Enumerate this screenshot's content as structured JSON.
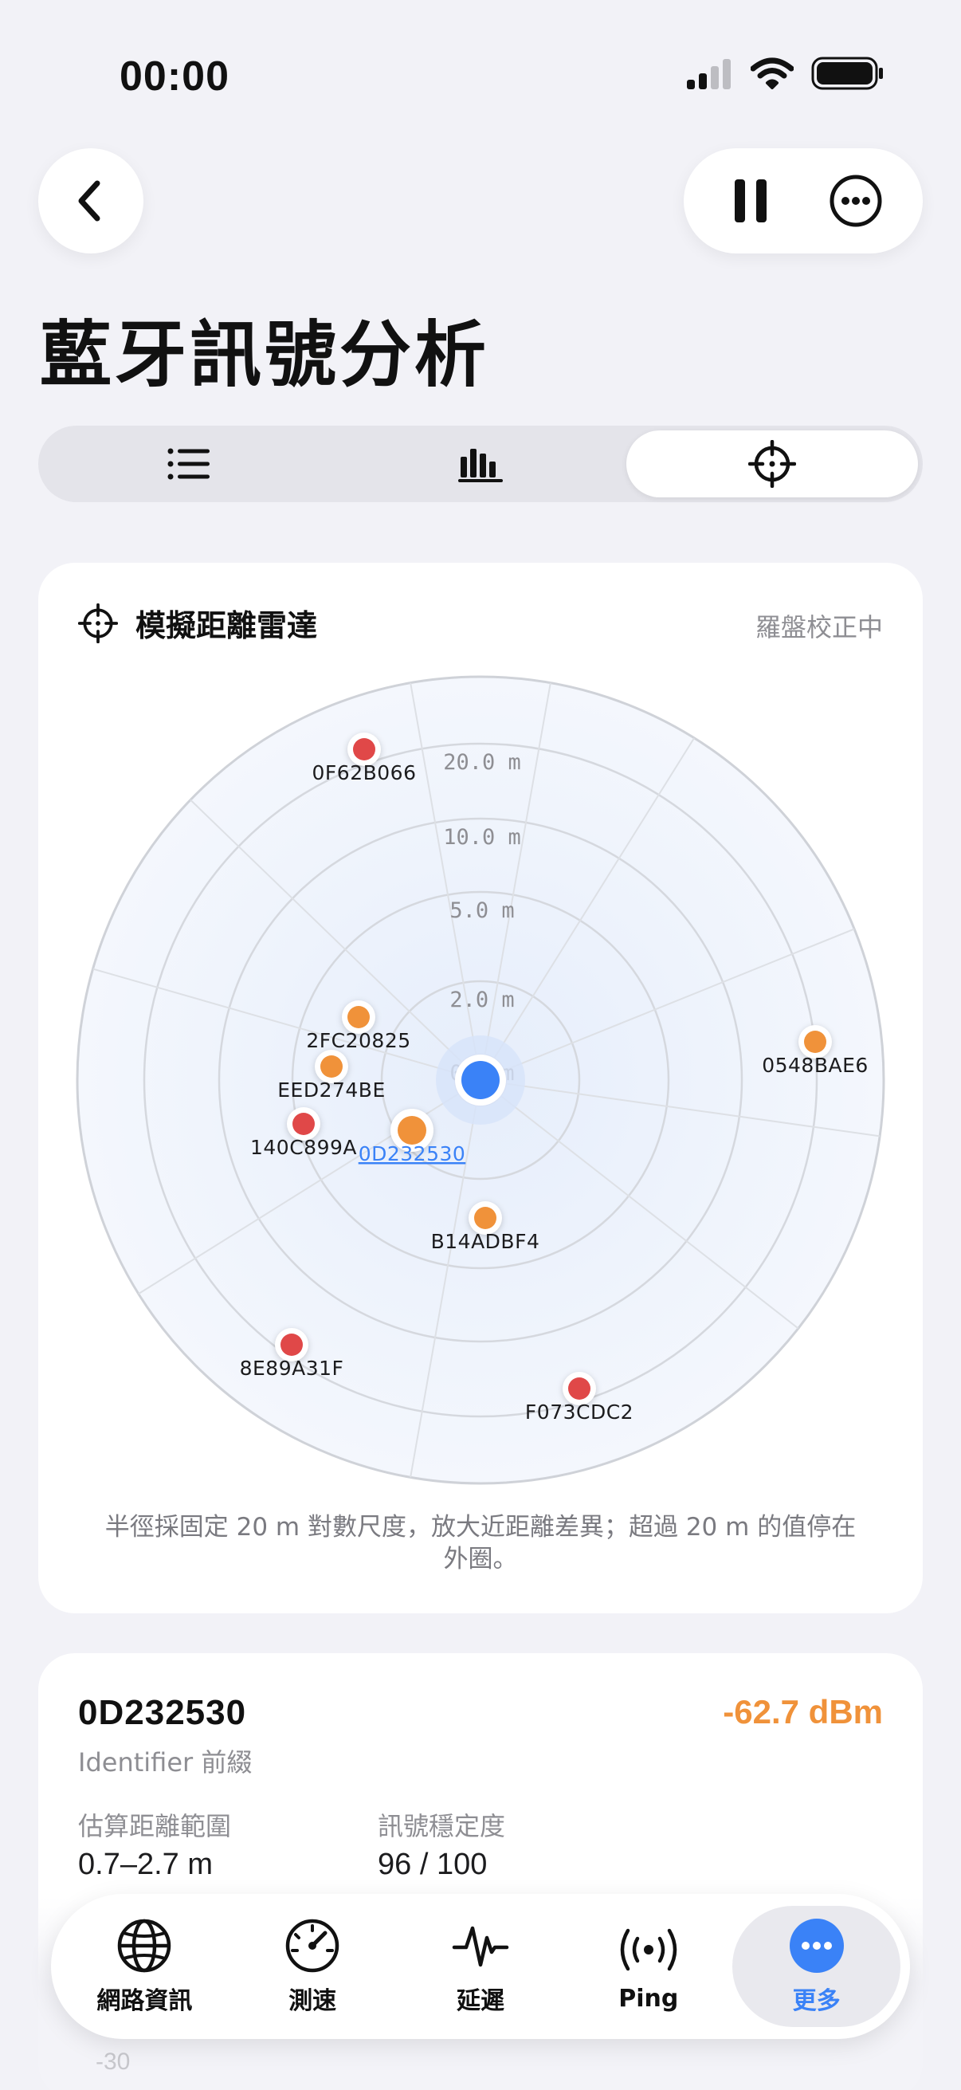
{
  "status_bar": {
    "time": "00:00"
  },
  "page": {
    "title": "藍牙訊號分析"
  },
  "radar_card": {
    "title": "模擬距離雷達",
    "status": "羅盤校正中",
    "ring_labels": [
      "20.0 m",
      "10.0 m",
      "5.0 m",
      "2.0 m",
      "0.5 m"
    ],
    "devices": [
      {
        "id": "0F62B066",
        "color": "#e04848"
      },
      {
        "id": "0548BAE6",
        "color": "#f0923a"
      },
      {
        "id": "2FC20825",
        "color": "#f0923a"
      },
      {
        "id": "EED274BE",
        "color": "#f0923a"
      },
      {
        "id": "140C899A",
        "color": "#e04848"
      },
      {
        "id": "0D232530",
        "color": "#f0923a",
        "selected": true
      },
      {
        "id": "B14ADBF4",
        "color": "#f0923a"
      },
      {
        "id": "8E89A31F",
        "color": "#e04848"
      },
      {
        "id": "F073CDC2",
        "color": "#e04848"
      }
    ],
    "note": "半徑採固定 20 m 對數尺度，放大近距離差異；超過 20 m 的值停在外圈。"
  },
  "detail": {
    "device_id": "0D232530",
    "subtitle": "Identifier 前綴",
    "rssi": "-62.7 dBm",
    "distance_label": "估算距離範圍",
    "distance_value": "0.7–2.7 m",
    "stability_label": "訊號穩定度",
    "stability_value": "96 / 100",
    "ghost_axis": "-30"
  },
  "tabbar": {
    "items": [
      {
        "label": "網路資訊",
        "icon": "globe-icon"
      },
      {
        "label": "測速",
        "icon": "speedometer-icon"
      },
      {
        "label": "延遲",
        "icon": "waveform-icon"
      },
      {
        "label": "Ping",
        "icon": "antenna-icon"
      },
      {
        "label": "更多",
        "icon": "more-icon",
        "active": true
      }
    ]
  },
  "colors": {
    "accent": "#3a82f7",
    "warning": "#f0923a",
    "danger": "#e04848"
  }
}
